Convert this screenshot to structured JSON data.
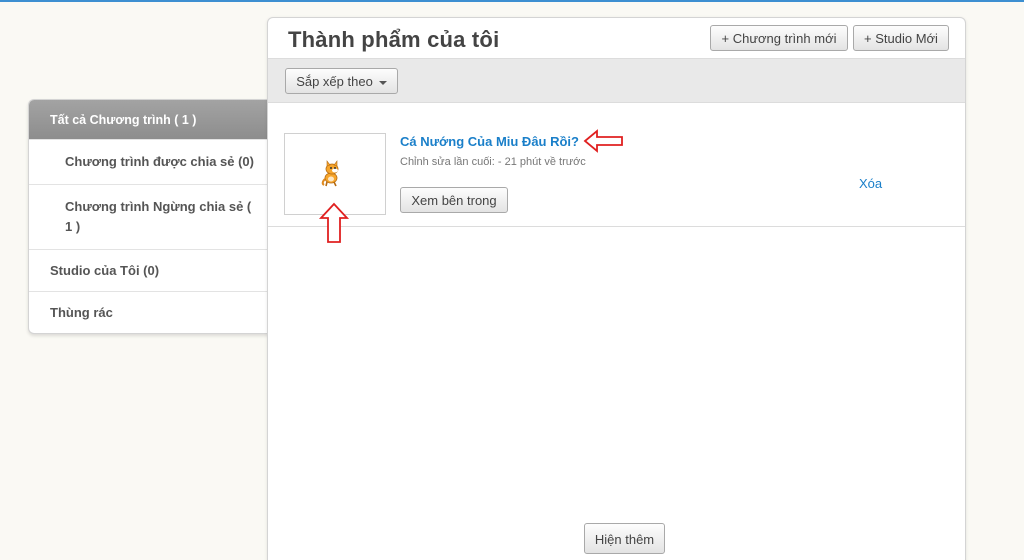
{
  "page": {
    "title": "Thành phẩm của tôi"
  },
  "header": {
    "new_program_label": "+ Chương trình mới",
    "new_studio_label": "+ Studio Mới"
  },
  "toolbar": {
    "sort_label": "Sắp xếp theo"
  },
  "sidebar": {
    "items": [
      {
        "label": "Tất cả Chương trình ( 1 )"
      },
      {
        "label": "Chương trình được chia sẻ (0)"
      },
      {
        "label": "Chương trình Ngừng chia sẻ ( 1 )"
      },
      {
        "label": "Studio của Tôi (0)"
      },
      {
        "label": "Thùng rác"
      }
    ]
  },
  "project": {
    "title": "Cá Nướng Của Miu Đâu Rồi?",
    "edited": "Chỉnh sửa lần cuối: - 21 phút về trước",
    "see_inside_label": "Xem bên trong",
    "delete_label": "Xóa"
  },
  "footer": {
    "load_more_label": "Hiện thêm"
  },
  "colors": {
    "accent": "#1a7fc9",
    "top_bar": "#3d8fd1",
    "annotation_arrow": "#e02020",
    "sidebar_active": "#969696"
  }
}
